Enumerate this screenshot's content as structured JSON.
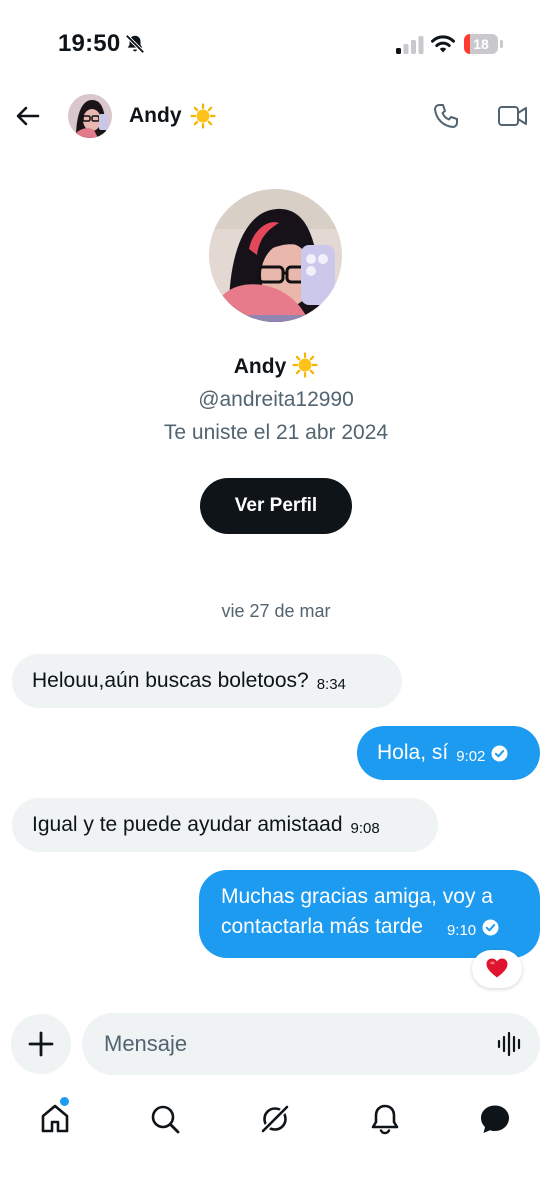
{
  "status_bar": {
    "time": "19:50",
    "battery_level": "18",
    "battery_fraction": 0.18,
    "icons": [
      "bell-slash-icon",
      "signal-icon",
      "wifi-icon",
      "battery-icon"
    ]
  },
  "header": {
    "name": "Andy",
    "icons": [
      "back-arrow-icon",
      "phone-icon",
      "video-camera-icon",
      "sun-emoji-icon"
    ]
  },
  "profile": {
    "name": "Andy",
    "handle": "@andreita12990",
    "joined": "Te uniste el 21 abr 2024",
    "view_profile_label": "Ver Perfil"
  },
  "conversation": {
    "date": "vie 27 de mar",
    "messages": [
      {
        "direction": "incoming",
        "text": "Helouu,aún buscas boletoos?",
        "time": "8:34"
      },
      {
        "direction": "outgoing",
        "text": "Hola, sí",
        "time": "9:02"
      },
      {
        "direction": "incoming",
        "text": "Igual y te puede ayudar amistaad",
        "time": "9:08"
      },
      {
        "direction": "outgoing",
        "text_line1": "Muchas gracias amiga, voy a",
        "text_line2": "contactarla más tarde",
        "time": "9:10",
        "reaction": "❤️"
      }
    ]
  },
  "composer": {
    "placeholder": "Mensaje",
    "icons": [
      "plus-icon",
      "voice-waveform-icon"
    ]
  },
  "bottom_nav": {
    "items": [
      "home-icon",
      "search-icon",
      "grok-icon",
      "notifications-icon",
      "messages-icon"
    ]
  },
  "colors": {
    "accent": "#1d9bf0",
    "text": "#0f1419",
    "secondary_text": "#536471",
    "bubble_incoming": "#eff3f4"
  }
}
